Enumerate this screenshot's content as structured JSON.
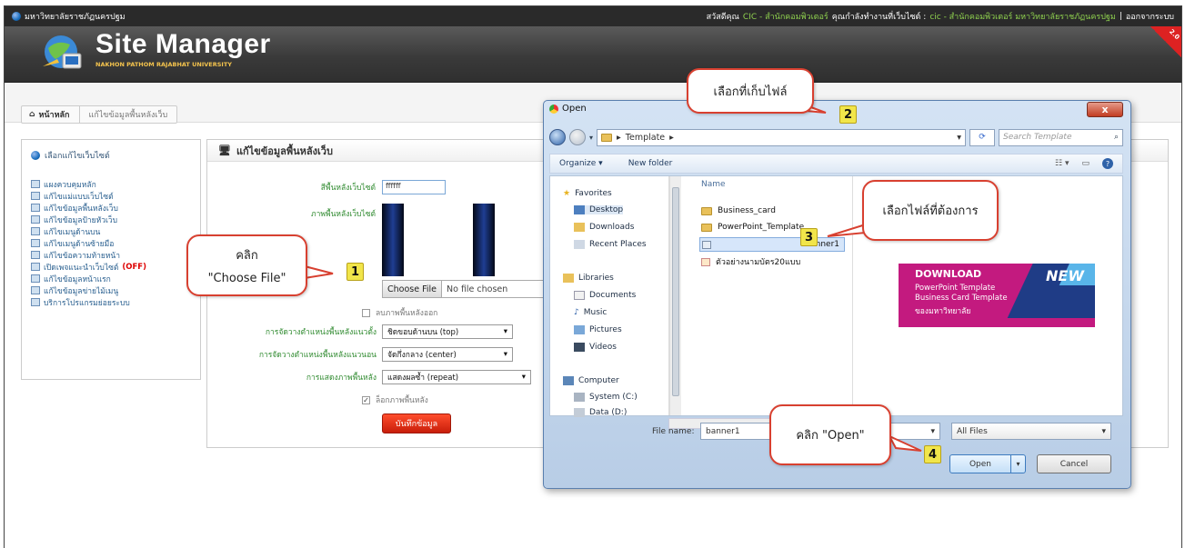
{
  "topbar": {
    "site_name": "มหาวิทยาลัยราชภัฏนครปฐม",
    "greeting": "สวัสดีคุณ",
    "user": "CIC - สำนักคอมพิวเตอร์",
    "working_on": "คุณกำลังทำงานที่เว็บไซต์ :",
    "site": "cic - สำนักคอมพิวเตอร์ มหาวิทยาลัยราชภัฏนครปฐม",
    "separator": "|",
    "logout": "ออกจากระบบ"
  },
  "header": {
    "title": "Site Manager",
    "subtitle": "NAKHON PATHOM RAJABHAT UNIVERSITY",
    "version_badge": "2.0"
  },
  "breadcrumb": {
    "home": "หน้าหลัก",
    "current": "แก้ไขข้อมูลพื้นหลังเว็บ"
  },
  "sidebar": {
    "select_site": "เลือกแก้ไขเว็บไซต์",
    "items": [
      {
        "label": "แผงควบคุมหลัก"
      },
      {
        "label": "แก้ไขแม่แบบเว็บไซต์"
      },
      {
        "label": "แก้ไขข้อมูลพื้นหลังเว็บ"
      },
      {
        "label": "แก้ไขข้อมูลป้ายหัวเว็บ"
      },
      {
        "label": "แก้ไขเมนูด้านบน"
      },
      {
        "label": "แก้ไขเมนูด้านซ้ายมือ"
      },
      {
        "label": "แก้ไขข้อความท้ายหน้า"
      },
      {
        "label": "เปิดเพจแนะนำเว็บไซต์",
        "badge": "(OFF)"
      },
      {
        "label": "แก้ไขข้อมูลหน้าแรก"
      },
      {
        "label": "แก้ไขข้อมูลข่ายไม้เมนู"
      },
      {
        "label": "บริการโปรแกรมย่อยระบบ"
      }
    ]
  },
  "form": {
    "title": "แก้ไขข้อมูลพื้นหลังเว็บ",
    "bg_color_label": "สีพื้นหลังเว็บไซต์",
    "bg_color_value": "ffffff",
    "bg_image_label": "ภาพพื้นหลังเว็บไซต์",
    "choose_file": "Choose File",
    "no_file": "No file chosen",
    "remove_bg_label": "ลบภาพพื้นหลังออก",
    "valign_label": "การจัดวางตำแหน่งพื้นหลังแนวตั้ง",
    "valign_value": "ชิดขอบด้านบน (top)",
    "halign_label": "การจัดวางตำแหน่งพื้นหลังแนวนอน",
    "halign_value": "จัดกึ่งกลาง (center)",
    "display_label": "การแสดงภาพพื้นหลัง",
    "display_value": "แสดงผลซ้ำ (repeat)",
    "lock_bg_label": "ล็อกภาพพื้นหลัง",
    "lock_bg_checked": true,
    "save": "บันทึกข้อมูล"
  },
  "dialog": {
    "title": "Open",
    "close": "x",
    "path": "Template",
    "search_placeholder": "Search Template",
    "organize": "Organize ▾",
    "new_folder": "New folder",
    "nav": {
      "favorites": "Favorites",
      "desktop": "Desktop",
      "downloads": "Downloads",
      "recent": "Recent Places",
      "libraries": "Libraries",
      "documents": "Documents",
      "music": "Music",
      "pictures": "Pictures",
      "videos": "Videos",
      "computer": "Computer",
      "system_c": "System (C:)",
      "data_d": "Data (D:)"
    },
    "column_name": "Name",
    "files": [
      {
        "name": "Business_card",
        "type": "folder"
      },
      {
        "name": "PowerPoint_Template",
        "type": "folder"
      },
      {
        "name": "banner1",
        "type": "image",
        "selected": true
      },
      {
        "name": "ตัวอย่างนามบัตร20แบบ",
        "type": "doc"
      }
    ],
    "promo": {
      "download": "DOWNLOAD",
      "new": "NEW",
      "line1": "PowerPoint Template",
      "line2": "Business Card Template",
      "line3": "ของมหาวิทยาลัย"
    },
    "filename_label": "File name:",
    "filename_value": "banner1",
    "filetype": "All Files",
    "open": "Open",
    "cancel": "Cancel"
  },
  "callouts": [
    {
      "number": "1",
      "text_line1": "คลิก",
      "text_line2": "\"Choose File\""
    },
    {
      "number": "2",
      "text": "เลือกที่เก็บไฟล์"
    },
    {
      "number": "3",
      "text": "เลือกไฟล์ที่ต้องการ"
    },
    {
      "number": "4",
      "text": "คลิก \"Open\""
    }
  ],
  "colors": {
    "accent_red": "#d84030",
    "callout_badge": "#f1e54a",
    "promo_magenta": "#c31a7f",
    "link_green": "#2f8a2f"
  }
}
